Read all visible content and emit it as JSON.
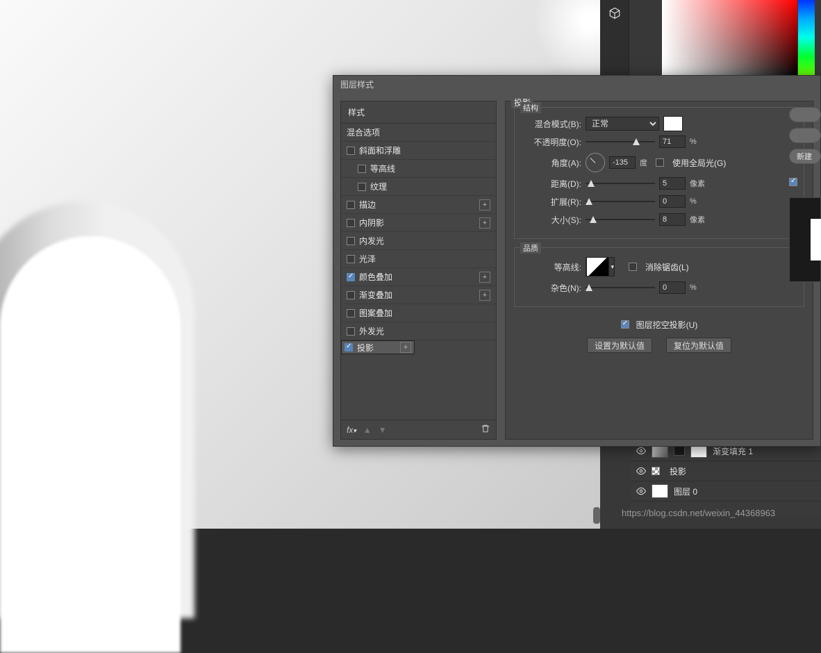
{
  "dialog": {
    "title": "图层样式",
    "panel_title": "投影",
    "styles_header": "样式",
    "items": [
      {
        "label": "混合选项"
      },
      {
        "label": "斜面和浮雕",
        "check": true
      },
      {
        "label": "等高线",
        "indent": true,
        "check": true
      },
      {
        "label": "纹理",
        "indent": true,
        "check": true
      },
      {
        "label": "描边",
        "check": true,
        "plus": true
      },
      {
        "label": "内阴影",
        "check": true,
        "plus": true
      },
      {
        "label": "内发光",
        "check": true
      },
      {
        "label": "光泽",
        "check": true
      },
      {
        "label": "颜色叠加",
        "check": true,
        "checked": true,
        "plus": true
      },
      {
        "label": "渐变叠加",
        "check": true,
        "plus": true
      },
      {
        "label": "图案叠加",
        "check": true
      },
      {
        "label": "外发光",
        "check": true
      },
      {
        "label": "投影",
        "check": true,
        "checked": true,
        "plus": true,
        "sel": true
      }
    ],
    "structure": {
      "legend": "结构",
      "blend_mode_label": "混合模式(B):",
      "blend_mode": "正常",
      "opacity_label": "不透明度(O):",
      "opacity": "71",
      "opacity_unit": "%",
      "angle_label": "角度(A):",
      "angle": "-135",
      "angle_unit": "度",
      "global_light": "使用全局光(G)",
      "distance_label": "距离(D):",
      "distance": "5",
      "px_unit": "像素",
      "spread_label": "扩展(R):",
      "spread": "0",
      "pct_unit": "%",
      "size_label": "大小(S):",
      "size": "8"
    },
    "quality": {
      "legend": "品质",
      "contour_label": "等高线:",
      "anti_alias": "消除锯齿(L)",
      "noise_label": "杂色(N):",
      "noise": "0",
      "noise_unit": "%"
    },
    "knockout": "图层挖空投影(U)",
    "make_default": "设置为默认值",
    "reset_default": "复位为默认值"
  },
  "rightbtn_new": "新建",
  "layers": {
    "row1": "渐变填充 1",
    "row2": "投影",
    "row3": "图层 0"
  },
  "watermark": "https://blog.csdn.net/weixin_44368963"
}
